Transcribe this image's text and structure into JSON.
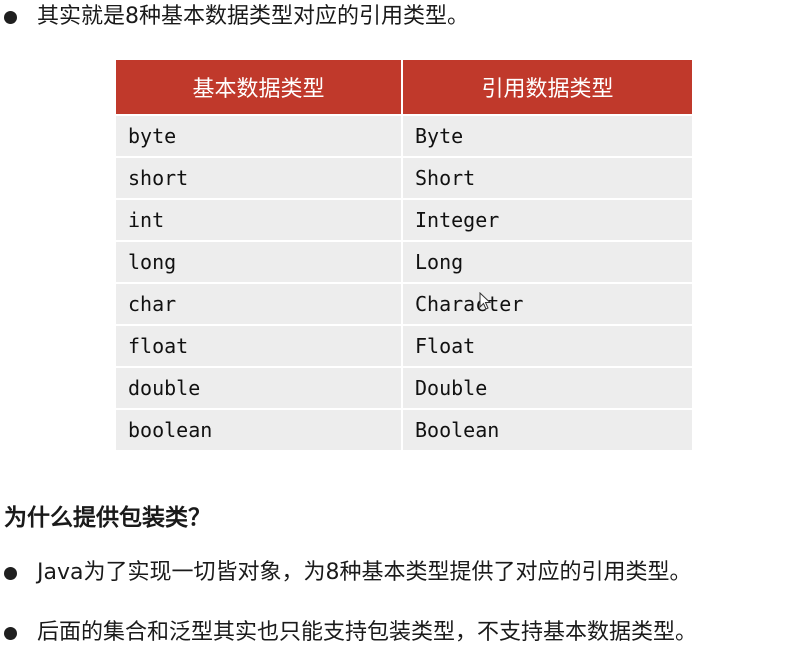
{
  "intro": {
    "text": "其实就是8种基本数据类型对应的引用类型。"
  },
  "table": {
    "headers": [
      "基本数据类型",
      "引用数据类型"
    ],
    "rows": [
      [
        "byte",
        "Byte"
      ],
      [
        "short",
        "Short"
      ],
      [
        "int",
        "Integer"
      ],
      [
        "long",
        "Long"
      ],
      [
        "char",
        "Character"
      ],
      [
        "float",
        "Float"
      ],
      [
        "double",
        "Double"
      ],
      [
        "boolean",
        "Boolean"
      ]
    ],
    "header_color": "#c0392b",
    "row_color": "#ededed"
  },
  "section": {
    "heading": "为什么提供包装类？",
    "bullets": [
      "Java为了实现一切皆对象，为8种基本类型提供了对应的引用类型。",
      "后面的集合和泛型其实也只能支持包装类型，不支持基本数据类型。"
    ]
  },
  "icons": {
    "bullet": "bullet-dot-icon",
    "cursor": "mouse-pointer-icon"
  }
}
